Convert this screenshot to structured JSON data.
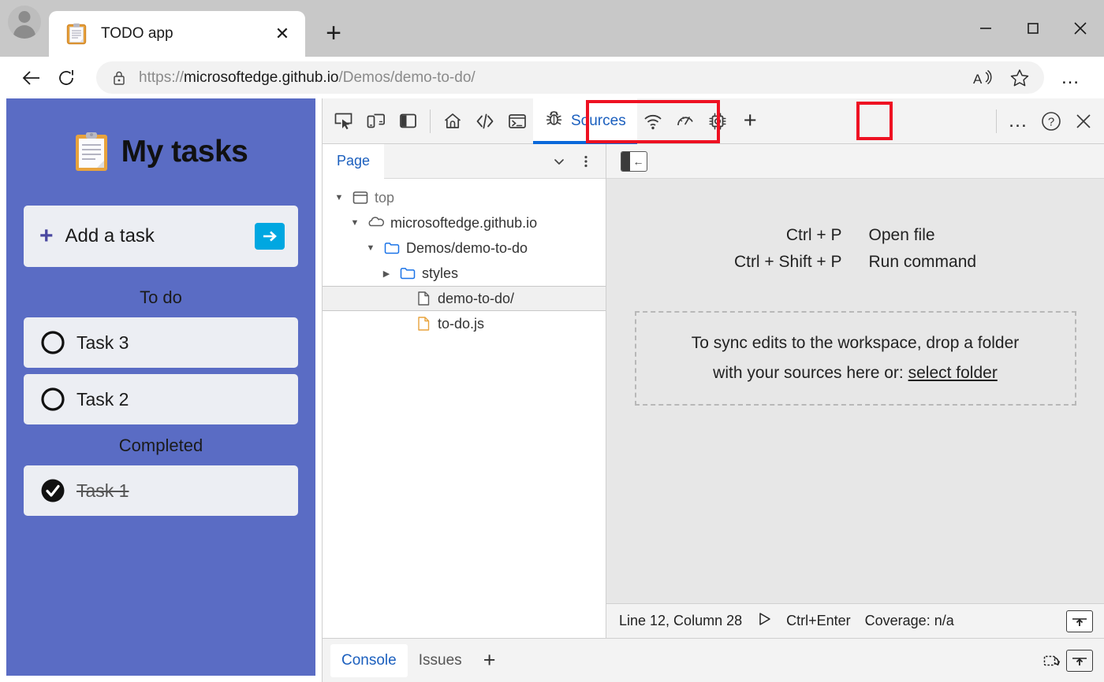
{
  "window": {
    "controls": [
      {
        "name": "minimize",
        "glyph": "—"
      },
      {
        "name": "maximize",
        "glyph": "◻"
      },
      {
        "name": "close",
        "glyph": "✕"
      }
    ]
  },
  "tab": {
    "title": "TODO app",
    "favicon": "clipboard-icon",
    "close_glyph": "✕",
    "new_tab_glyph": "+"
  },
  "navbar": {
    "back_glyph": "←",
    "reload_glyph": "⟳",
    "lock_icon": "lock-icon",
    "url_prefix": "https://",
    "url_domain": "microsoftedge.github.io",
    "url_path": "/Demos/demo-to-do/",
    "read_aloud_icon": "read-aloud-icon",
    "favorite_icon": "star-icon",
    "more_glyph": "…"
  },
  "todo_app": {
    "title": "My tasks",
    "logo_icon": "clipboard-icon",
    "add_task": {
      "plus_glyph": "+",
      "label": "Add a task",
      "submit_icon": "arrow-right-icon"
    },
    "sections": [
      {
        "label": "To do",
        "tasks": [
          {
            "label": "Task 3",
            "done": false
          },
          {
            "label": "Task 2",
            "done": false
          }
        ]
      },
      {
        "label": "Completed",
        "tasks": [
          {
            "label": "Task 1",
            "done": true
          }
        ]
      }
    ]
  },
  "devtools": {
    "toolbar": {
      "left_icons": [
        {
          "name": "inspect-element-icon"
        },
        {
          "name": "device-toolbar-icon"
        },
        {
          "name": "dock-side-icon"
        }
      ],
      "panel_icons": [
        {
          "name": "welcome-home-icon"
        },
        {
          "name": "elements-icon"
        },
        {
          "name": "console-icon"
        }
      ],
      "active_tab": {
        "label": "Sources",
        "icon": "bug-sources-icon"
      },
      "right_panel_icons": [
        {
          "name": "network-icon"
        },
        {
          "name": "performance-icon"
        },
        {
          "name": "memory-chip-icon"
        }
      ],
      "add_panel_glyph": "+",
      "more_tools_glyph": "…",
      "help_glyph": "?",
      "close_glyph": "✕",
      "highlights": [
        "sources-tab",
        "add-panel-button"
      ],
      "highlight_color": "#ee1122",
      "active_underline_color": "#0a68da"
    },
    "navigator": {
      "tab_label": "Page",
      "more_tabs_glyph": "⌄",
      "menu_glyph": "⋮",
      "tree": [
        {
          "label": "top",
          "indent": 0,
          "twisty": "open",
          "icon": "frame-icon",
          "muted": true,
          "selected": false
        },
        {
          "label": "microsoftedge.github.io",
          "indent": 1,
          "twisty": "open",
          "icon": "cloud-icon",
          "muted": false,
          "selected": false
        },
        {
          "label": "Demos/demo-to-do",
          "indent": 2,
          "twisty": "open",
          "icon": "folder-icon",
          "muted": false,
          "selected": false
        },
        {
          "label": "styles",
          "indent": 3,
          "twisty": "closed",
          "icon": "folder-icon",
          "muted": false,
          "selected": false
        },
        {
          "label": "demo-to-do/",
          "indent": 4,
          "twisty": "none",
          "icon": "document-icon",
          "muted": false,
          "selected": true
        },
        {
          "label": "to-do.js",
          "indent": 4,
          "twisty": "none",
          "icon": "js-file-icon",
          "muted": false,
          "selected": false
        }
      ]
    },
    "editor": {
      "collapse_icon": "collapse-sidebar-icon",
      "shortcuts": [
        {
          "keys": "Ctrl + P",
          "desc": "Open file"
        },
        {
          "keys": "Ctrl + Shift + P",
          "desc": "Run command"
        }
      ],
      "dropzone": {
        "line1": "To sync edits to the workspace, drop a folder",
        "line2_prefix": "with your sources here or: ",
        "link": "select folder"
      },
      "status": {
        "position": "Line 12, Column 28",
        "run_glyph": "▷",
        "run_shortcut": "Ctrl+Enter",
        "coverage": "Coverage: n/a",
        "action_icon": "open-in-panel-icon"
      }
    },
    "drawer": {
      "tabs": [
        {
          "label": "Console",
          "active": true
        },
        {
          "label": "Issues",
          "active": false
        }
      ],
      "add_glyph": "+",
      "right_icons": [
        {
          "name": "restore-drawer-icon"
        },
        {
          "name": "open-in-panel-icon"
        }
      ]
    }
  }
}
